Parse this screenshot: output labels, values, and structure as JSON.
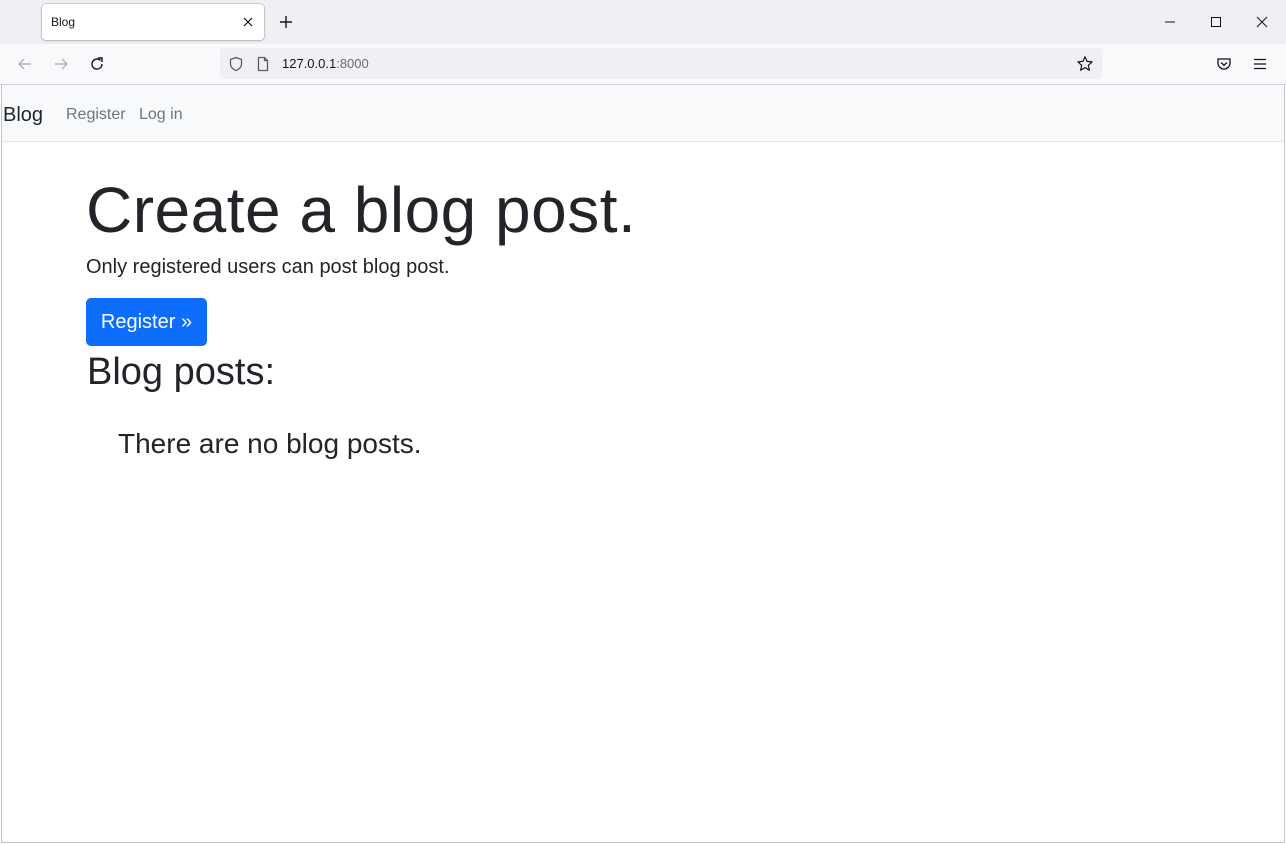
{
  "browser": {
    "tab": {
      "title": "Blog"
    },
    "url": {
      "host": "127.0.0.1",
      "port": ":8000"
    }
  },
  "site": {
    "brand": "Blog",
    "nav": {
      "register": "Register",
      "login": "Log in"
    },
    "hero": {
      "title": "Create a blog post.",
      "lead": "Only registered users can post blog post.",
      "button": "Register »"
    },
    "posts": {
      "heading": "Blog posts:",
      "empty": "There are no blog posts."
    }
  },
  "colors": {
    "primary": "#0d6efd",
    "navbar_bg": "#f8f9fa",
    "text": "#212529",
    "muted_link": "#6c757d"
  }
}
